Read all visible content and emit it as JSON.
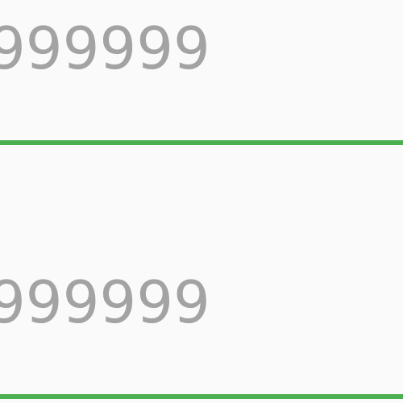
{
  "fields": [
    {
      "value": "999999",
      "underline_color": "#4caf50",
      "text_color": "#a3a3a3"
    },
    {
      "value": "999999",
      "underline_color": "#4caf50",
      "text_color": "#a3a3a3"
    }
  ],
  "background_color": "#fafafa"
}
